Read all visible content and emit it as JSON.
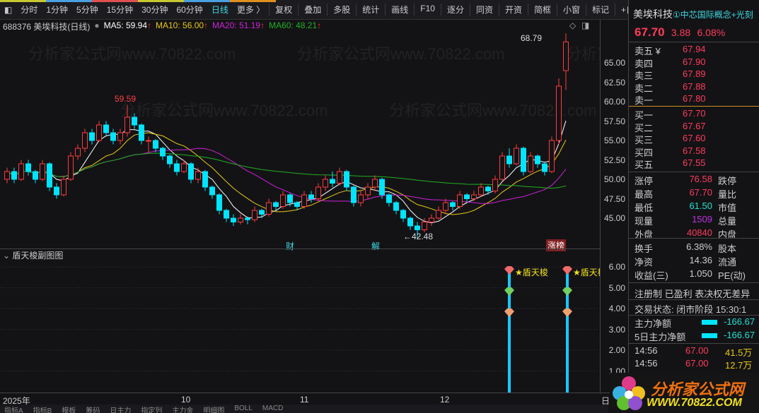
{
  "toolbar": {
    "periods": [
      "分时",
      "1分钟",
      "5分钟",
      "15分钟",
      "30分钟",
      "60分钟",
      "日线",
      "更多 〉"
    ],
    "active": "日线",
    "buttons": [
      "复权",
      "叠加",
      "多股",
      "统计",
      "画线",
      "F10",
      "逐分",
      "同资",
      "开资",
      "简框",
      "小窗",
      "标记",
      "+自选",
      "返回"
    ]
  },
  "info": {
    "title": "688376 美埃科技(日线)",
    "ma5": "MA5: 59.94",
    "ma10": "MA10: 56.00",
    "ma20": "MA20: 51.19",
    "ma60": "MA60: 48.21",
    "arrow": "↑"
  },
  "colors": {
    "up": "#ff3b3b",
    "down": "#00e5ff",
    "ma5": "#ffffff",
    "ma10": "#e8c818",
    "ma20": "#d020d8",
    "ma60": "#20b020",
    "signal": "#18c8ff"
  },
  "price_labels": {
    "high": "68.79",
    "peak": "59.59",
    "low": "42.48"
  },
  "markers": {
    "cai": "财",
    "jie": "解",
    "zhangbang": "涨榜"
  },
  "y_axis": [
    "65.00",
    "62.50",
    "60.00",
    "57.50",
    "55.00",
    "52.50",
    "50.00",
    "47.50",
    "45.00"
  ],
  "sub": {
    "title": "盾天梭副图图",
    "signal_label": "★盾天梭",
    "y_axis": [
      "6.00",
      "5.00",
      "4.00",
      "3.00",
      "2.00",
      "1.00"
    ]
  },
  "x_axis": {
    "labels": [
      "2025年",
      "10",
      "11",
      "12"
    ],
    "right": "日"
  },
  "bottom_tabs": [
    "指标A",
    "指标B",
    "模板",
    "筹码",
    "日主力",
    "指定列",
    "主力金",
    "明细图",
    "BOLL",
    "MACD"
  ],
  "chart_data": {
    "type": "candlestick",
    "ylim": [
      42,
      70
    ],
    "ohlc": [
      [
        50,
        51.5,
        49.5,
        51
      ],
      [
        51,
        51.5,
        49.5,
        50
      ],
      [
        50,
        52.5,
        49.8,
        52
      ],
      [
        52,
        52.5,
        50.5,
        51
      ],
      [
        51,
        51.2,
        49.5,
        50
      ],
      [
        50,
        52.5,
        49.8,
        52
      ],
      [
        52,
        52.2,
        48.5,
        49
      ],
      [
        49,
        49.5,
        47.5,
        48
      ],
      [
        48,
        50.5,
        47.8,
        50
      ],
      [
        50,
        53.5,
        49.8,
        53
      ],
      [
        53,
        54.5,
        52.5,
        54
      ],
      [
        54,
        56.5,
        53.5,
        56
      ],
      [
        56,
        56.5,
        54.5,
        55
      ],
      [
        55,
        57.5,
        54.8,
        57
      ],
      [
        57,
        57.5,
        55.5,
        56
      ],
      [
        56,
        56.5,
        54.5,
        55
      ],
      [
        55,
        56.5,
        54.5,
        56
      ],
      [
        56,
        59.59,
        55.5,
        58
      ],
      [
        58,
        58.5,
        56.5,
        57
      ],
      [
        57,
        57.2,
        54.5,
        55
      ],
      [
        55,
        55.5,
        53.5,
        55
      ],
      [
        55,
        55.2,
        53.5,
        54
      ],
      [
        54,
        54.2,
        52.5,
        53
      ],
      [
        53,
        53.2,
        51.5,
        52
      ],
      [
        52,
        52.5,
        50.5,
        51
      ],
      [
        51,
        52.5,
        50.8,
        52
      ],
      [
        52,
        52.2,
        49.5,
        50
      ],
      [
        50,
        51.5,
        49.5,
        51
      ],
      [
        51,
        51.2,
        48.5,
        49
      ],
      [
        49,
        49.2,
        47.5,
        48
      ],
      [
        48,
        48.2,
        45.5,
        46
      ],
      [
        46,
        46.2,
        44.5,
        45
      ],
      [
        45,
        45.5,
        44,
        44.5
      ],
      [
        44.5,
        45.5,
        44.2,
        45
      ],
      [
        45,
        45.2,
        44.2,
        44.8
      ],
      [
        44.8,
        46.5,
        44.5,
        46
      ],
      [
        46,
        46.2,
        45,
        45.5
      ],
      [
        45.5,
        47.5,
        45.2,
        47
      ],
      [
        47,
        47.2,
        46,
        46.5
      ],
      [
        46.5,
        48.5,
        46.2,
        48
      ],
      [
        48,
        48.2,
        46.5,
        47
      ],
      [
        47,
        47.2,
        46,
        46.5
      ],
      [
        46.5,
        48.5,
        46.2,
        48
      ],
      [
        48,
        48.5,
        47,
        47.5
      ],
      [
        47.5,
        49.5,
        47.2,
        49
      ],
      [
        49,
        50.5,
        48.5,
        50
      ],
      [
        50,
        51,
        49,
        49.5
      ],
      [
        49.5,
        51.5,
        49.2,
        51
      ],
      [
        51,
        51.2,
        48.5,
        49
      ],
      [
        49,
        49.2,
        46.5,
        47
      ],
      [
        47,
        48.5,
        46.5,
        48
      ],
      [
        48,
        49.5,
        47.5,
        49
      ],
      [
        49,
        50.5,
        48.5,
        50
      ],
      [
        50,
        50.2,
        47.5,
        48
      ],
      [
        48,
        48.2,
        46.5,
        47
      ],
      [
        47,
        47.2,
        45.5,
        46
      ],
      [
        46,
        46.2,
        44.5,
        45
      ],
      [
        45,
        45.2,
        43.5,
        44
      ],
      [
        44,
        44.5,
        42.48,
        43.5
      ],
      [
        43.5,
        45,
        43.2,
        44.5
      ],
      [
        44.5,
        45.5,
        44,
        45
      ],
      [
        45,
        46.5,
        44.8,
        46
      ],
      [
        46,
        47.5,
        45.5,
        47
      ],
      [
        47,
        47.2,
        46,
        46.5
      ],
      [
        46.5,
        48.5,
        46.2,
        48
      ],
      [
        48,
        48.2,
        47,
        47.5
      ],
      [
        47.5,
        48.5,
        47.2,
        48
      ],
      [
        48,
        49.5,
        47.8,
        49
      ],
      [
        49,
        49.2,
        48,
        48.5
      ],
      [
        48.5,
        50.5,
        48.2,
        50
      ],
      [
        50,
        53.5,
        49.8,
        53
      ],
      [
        53,
        54,
        51.5,
        52
      ],
      [
        52,
        54.5,
        51.8,
        54
      ],
      [
        54,
        54.2,
        50.5,
        51
      ],
      [
        51,
        53.5,
        50.8,
        53
      ],
      [
        53,
        53.2,
        51.5,
        52
      ],
      [
        52,
        52.2,
        50.5,
        51
      ],
      [
        51,
        55.5,
        50.8,
        55
      ],
      [
        55,
        63,
        54.5,
        62
      ],
      [
        64,
        68.79,
        61.5,
        67.7
      ]
    ],
    "signals": [
      {
        "index": 72,
        "value": 5.8
      },
      {
        "index": 78,
        "value": 5.8
      }
    ]
  },
  "quote": {
    "name": "美埃科技",
    "concept": "①中芯国际概念+光刻",
    "price": "67.70",
    "change": "3.88",
    "pct": "6.08%",
    "asks": [
      {
        "label": "卖五 ¥",
        "price": "67.94"
      },
      {
        "label": "卖四",
        "price": "67.90"
      },
      {
        "label": "卖三",
        "price": "67.89"
      },
      {
        "label": "卖二",
        "price": "67.88"
      },
      {
        "label": "卖一",
        "price": "67.80"
      }
    ],
    "bids": [
      {
        "label": "买一",
        "price": "67.70"
      },
      {
        "label": "买二",
        "price": "67.67"
      },
      {
        "label": "买三",
        "price": "67.60"
      },
      {
        "label": "买四",
        "price": "67.58"
      },
      {
        "label": "买五",
        "price": "67.55"
      }
    ],
    "stats": [
      {
        "k": "涨停",
        "v": "76.58",
        "c": "#ff3b5a",
        "k2": "跌停"
      },
      {
        "k": "最高",
        "v": "67.70",
        "c": "#ff3b5a",
        "k2": "量比"
      },
      {
        "k": "最低",
        "v": "61.50",
        "c": "#20e0d0",
        "k2": "市值"
      },
      {
        "k": "现量",
        "v": "1509",
        "c": "#c030e0",
        "k2": "总量"
      },
      {
        "k": "外盘",
        "v": "40840",
        "c": "#ff3b5a",
        "k2": "内盘"
      }
    ],
    "stats2": [
      {
        "k": "换手",
        "v": "6.38%",
        "k2": "股本"
      },
      {
        "k": "净资",
        "v": "14.36",
        "k2": "流通"
      },
      {
        "k": "收益(三)",
        "v": "1.050",
        "k2": "PE(动)"
      }
    ],
    "tags": "注册制 已盈利 表决权无差异",
    "status": "交易状态: 闭市阶段 15:30:1",
    "flows": [
      {
        "k": "主力净额",
        "v": "-166.67"
      },
      {
        "k": "5日主力净额",
        "v": "-166.67"
      }
    ],
    "ticks": [
      {
        "t": "14:56",
        "p": "67.00",
        "v": "41.5万"
      },
      {
        "t": "14:56",
        "p": "67.00",
        "v": "12.7万"
      }
    ]
  },
  "logo": {
    "text": "分析家公式网",
    "url": "WWW.70822.COM"
  }
}
